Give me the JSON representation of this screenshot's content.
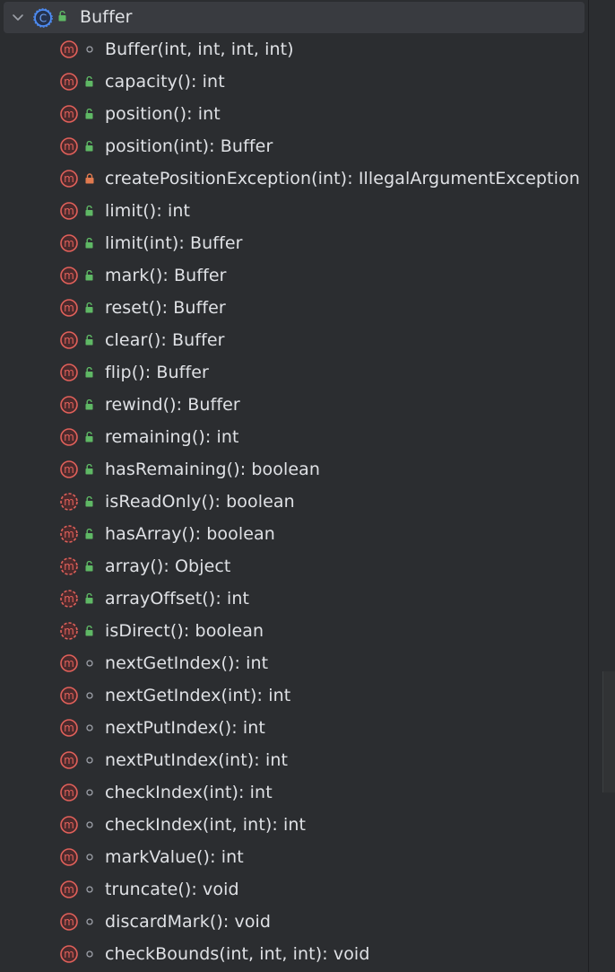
{
  "structure": {
    "class_name": "Buffer",
    "members": [
      {
        "label": "Buffer(int, int, int, int)",
        "visibility": "package",
        "abstract": false
      },
      {
        "label": "capacity(): int",
        "visibility": "public",
        "abstract": false
      },
      {
        "label": "position(): int",
        "visibility": "public",
        "abstract": false
      },
      {
        "label": "position(int): Buffer",
        "visibility": "public",
        "abstract": false
      },
      {
        "label": "createPositionException(int): IllegalArgumentException",
        "visibility": "private",
        "abstract": false
      },
      {
        "label": "limit(): int",
        "visibility": "public",
        "abstract": false
      },
      {
        "label": "limit(int): Buffer",
        "visibility": "public",
        "abstract": false
      },
      {
        "label": "mark(): Buffer",
        "visibility": "public",
        "abstract": false
      },
      {
        "label": "reset(): Buffer",
        "visibility": "public",
        "abstract": false
      },
      {
        "label": "clear(): Buffer",
        "visibility": "public",
        "abstract": false
      },
      {
        "label": "flip(): Buffer",
        "visibility": "public",
        "abstract": false
      },
      {
        "label": "rewind(): Buffer",
        "visibility": "public",
        "abstract": false
      },
      {
        "label": "remaining(): int",
        "visibility": "public",
        "abstract": false
      },
      {
        "label": "hasRemaining(): boolean",
        "visibility": "public",
        "abstract": false
      },
      {
        "label": "isReadOnly(): boolean",
        "visibility": "public",
        "abstract": true
      },
      {
        "label": "hasArray(): boolean",
        "visibility": "public",
        "abstract": true
      },
      {
        "label": "array(): Object",
        "visibility": "public",
        "abstract": true
      },
      {
        "label": "arrayOffset(): int",
        "visibility": "public",
        "abstract": true
      },
      {
        "label": "isDirect(): boolean",
        "visibility": "public",
        "abstract": true
      },
      {
        "label": "nextGetIndex(): int",
        "visibility": "package",
        "abstract": false
      },
      {
        "label": "nextGetIndex(int): int",
        "visibility": "package",
        "abstract": false
      },
      {
        "label": "nextPutIndex(): int",
        "visibility": "package",
        "abstract": false
      },
      {
        "label": "nextPutIndex(int): int",
        "visibility": "package",
        "abstract": false
      },
      {
        "label": "checkIndex(int): int",
        "visibility": "package",
        "abstract": false
      },
      {
        "label": "checkIndex(int, int): int",
        "visibility": "package",
        "abstract": false
      },
      {
        "label": "markValue(): int",
        "visibility": "package",
        "abstract": false
      },
      {
        "label": "truncate(): void",
        "visibility": "package",
        "abstract": false
      },
      {
        "label": "discardMark(): void",
        "visibility": "package",
        "abstract": false
      },
      {
        "label": "checkBounds(int, int, int): void",
        "visibility": "package",
        "abstract": false
      }
    ]
  },
  "icons": {
    "expand": "chevron-down-icon",
    "class": "class-icon",
    "method": "method-icon",
    "abstract_method": "abstract-method-icon",
    "public": "public-lock-open-icon",
    "private": "private-lock-icon",
    "package": "package-dot-icon"
  },
  "colors": {
    "background": "#2b2d30",
    "header_selection": "#393b40",
    "text": "#dfe1e5",
    "method_red": "#e0605a",
    "public_green": "#5fb865",
    "private_orange": "#e07a4f",
    "package_gray": "#9da0a8",
    "class_blue": "#4d8cf5"
  }
}
